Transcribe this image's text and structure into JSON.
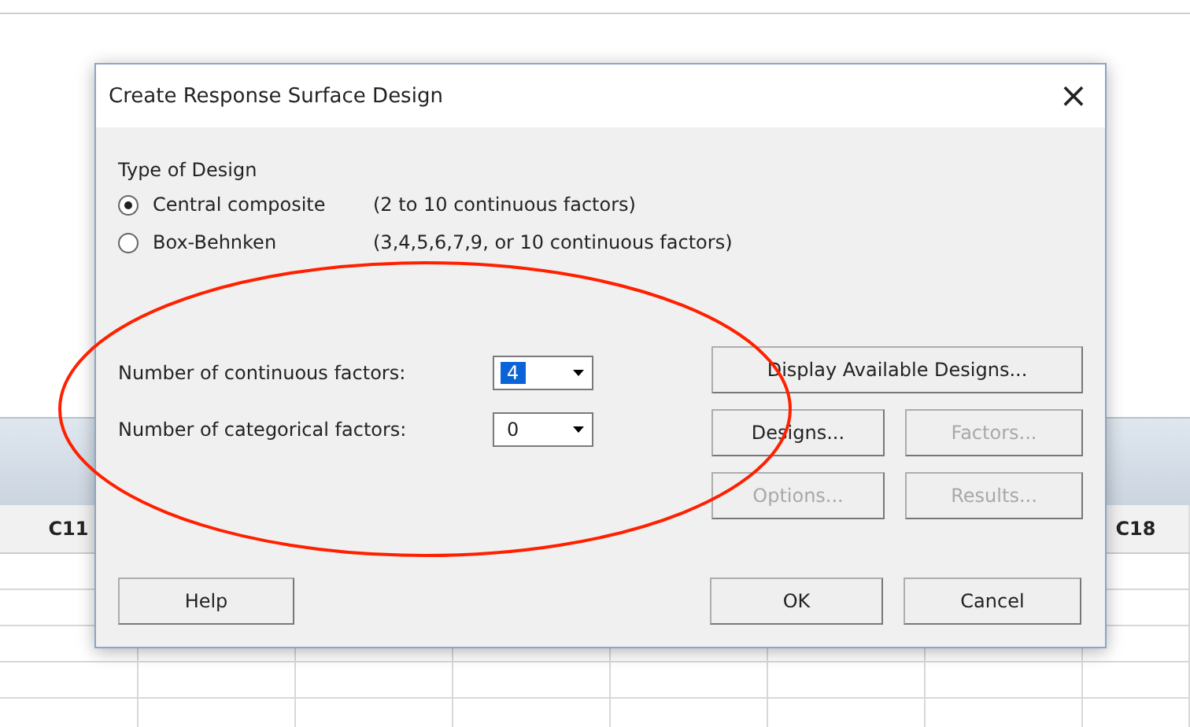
{
  "worksheet": {
    "column_headers": [
      "C11",
      "C18"
    ]
  },
  "dialog": {
    "title": "Create Response Surface Design",
    "close": "×",
    "design_type": {
      "label": "Type of Design",
      "options": [
        {
          "label": "Central composite",
          "note": "(2 to 10 continuous factors)",
          "selected": true
        },
        {
          "label": "Box-Behnken",
          "note": "(3,4,5,6,7,9, or 10 continuous factors)",
          "selected": false
        }
      ]
    },
    "fields": [
      {
        "label": "Number of continuous factors:",
        "value": "4",
        "focused": true
      },
      {
        "label": "Number of categorical factors:",
        "value": "0",
        "focused": false
      }
    ],
    "side_buttons": [
      {
        "label": "Display Available Designs...",
        "disabled": false
      },
      {
        "label": "Designs...",
        "disabled": false
      },
      {
        "label": "Factors...",
        "disabled": true
      },
      {
        "label": "Options...",
        "disabled": true
      },
      {
        "label": "Results...",
        "disabled": true
      }
    ],
    "footer_buttons": [
      {
        "label": "Help",
        "disabled": false
      },
      {
        "label": "OK",
        "disabled": false
      },
      {
        "label": "Cancel",
        "disabled": false
      }
    ]
  },
  "annotation": {
    "kind": "ellipse"
  }
}
